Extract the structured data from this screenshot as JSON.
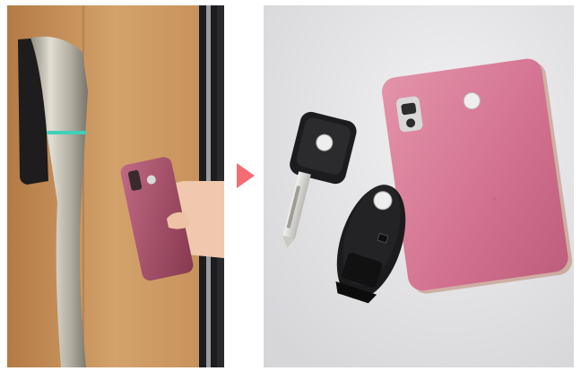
{
  "scene": {
    "left_photo": {
      "subject": "hand-holding-phone-at-door-handle-reader",
      "phone_color": "#a8506a",
      "door_color": "#c9955e",
      "handle_color": "#b7b3a6",
      "indicator_color": "#3fd0b8"
    },
    "arrow": {
      "color": "#f26c74"
    },
    "right_photo": {
      "items": [
        "phone",
        "key",
        "key-fob"
      ],
      "phone_color": "#d8708e",
      "key_color": "#222222",
      "background_color": "#e4e3e5"
    }
  }
}
